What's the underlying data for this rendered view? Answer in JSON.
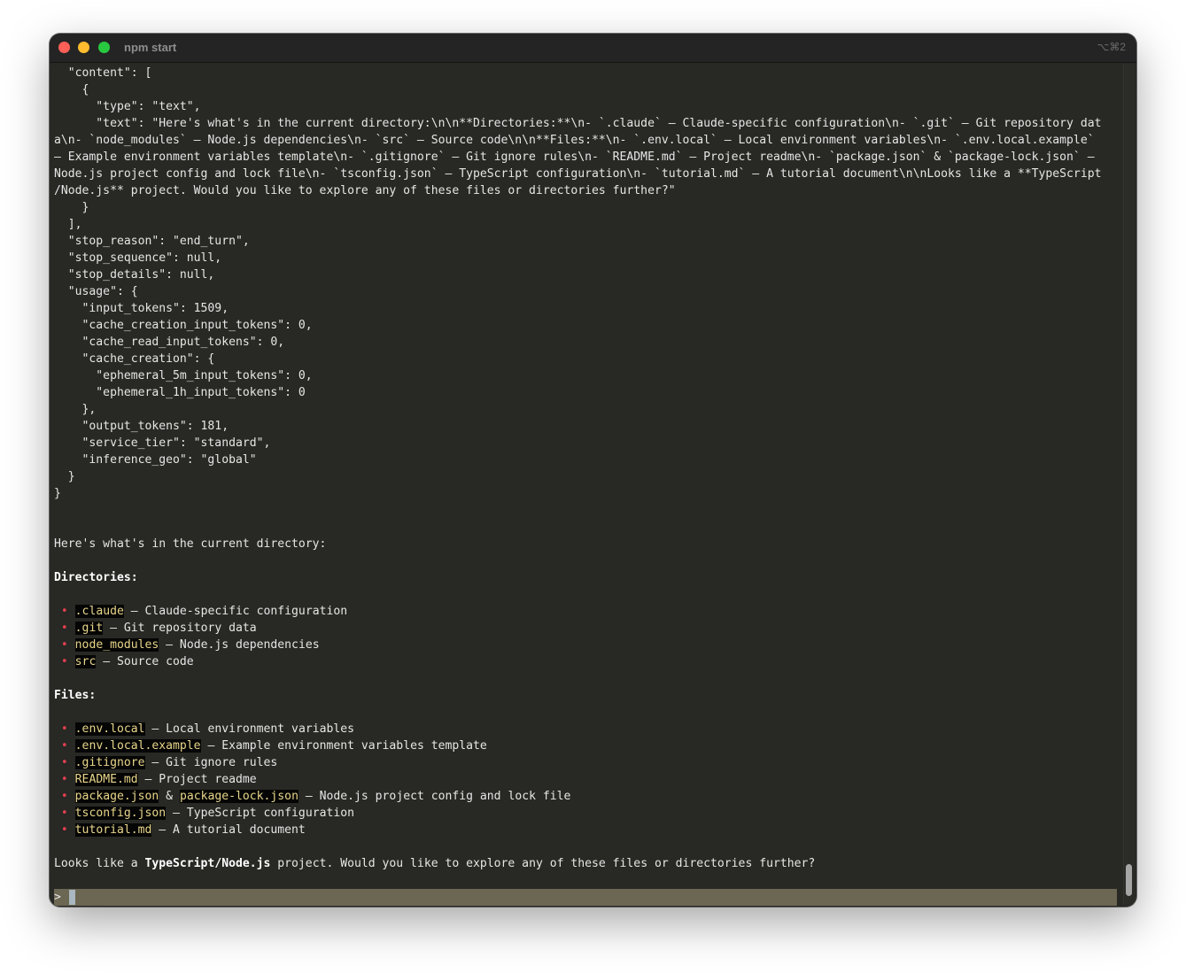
{
  "window": {
    "title": "npm start",
    "shortcut": "⌥⌘2"
  },
  "json_lines": [
    "  \"content\": [",
    "    {",
    "      \"type\": \"text\",",
    "      \"text\": \"Here's what's in the current directory:\\n\\n**Directories:**\\n- `.claude` — Claude-specific configuration\\n- `.git` — Git repository dat",
    "a\\n- `node_modules` — Node.js dependencies\\n- `src` — Source code\\n\\n**Files:**\\n- `.env.local` — Local environment variables\\n- `.env.local.example`",
    "— Example environment variables template\\n- `.gitignore` — Git ignore rules\\n- `README.md` — Project readme\\n- `package.json` & `package-lock.json` —",
    "Node.js project config and lock file\\n- `tsconfig.json` — TypeScript configuration\\n- `tutorial.md` — A tutorial document\\n\\nLooks like a **TypeScript",
    "/Node.js** project. Would you like to explore any of these files or directories further?\"",
    "    }",
    "  ],",
    "  \"stop_reason\": \"end_turn\",",
    "  \"stop_sequence\": null,",
    "  \"stop_details\": null,",
    "  \"usage\": {",
    "    \"input_tokens\": 1509,",
    "    \"cache_creation_input_tokens\": 0,",
    "    \"cache_read_input_tokens\": 0,",
    "    \"cache_creation\": {",
    "      \"ephemeral_5m_input_tokens\": 0,",
    "      \"ephemeral_1h_input_tokens\": 0",
    "    },",
    "    \"output_tokens\": 181,",
    "    \"service_tier\": \"standard\",",
    "    \"inference_geo\": \"global\"",
    "  }",
    "}"
  ],
  "response": {
    "intro": "Here's what's in the current directory:",
    "directories_heading": "Directories:",
    "directories": [
      {
        "name": ".claude",
        "desc": " — Claude-specific configuration"
      },
      {
        "name": ".git",
        "desc": " — Git repository data"
      },
      {
        "name": "node_modules",
        "desc": " — Node.js dependencies"
      },
      {
        "name": "src",
        "desc": " — Source code"
      }
    ],
    "files_heading": "Files:",
    "files": [
      {
        "name": ".env.local",
        "desc": " — Local environment variables"
      },
      {
        "name": ".env.local.example",
        "desc": " — Example environment variables template"
      },
      {
        "name": ".gitignore",
        "desc": " — Git ignore rules"
      },
      {
        "name": "README.md",
        "desc": " — Project readme"
      },
      {
        "name": "package.json",
        "mid": " & ",
        "name2": "package-lock.json",
        "desc": " — Node.js project config and lock file"
      },
      {
        "name": "tsconfig.json",
        "desc": " — TypeScript configuration"
      },
      {
        "name": "tutorial.md",
        "desc": " — A tutorial document"
      }
    ],
    "closing_pre": "Looks like a ",
    "closing_bold": "TypeScript/Node.js",
    "closing_post": " project. Would you like to explore any of these files or directories further?"
  },
  "bullet_char": "•",
  "prompt": {
    "char": ">"
  }
}
